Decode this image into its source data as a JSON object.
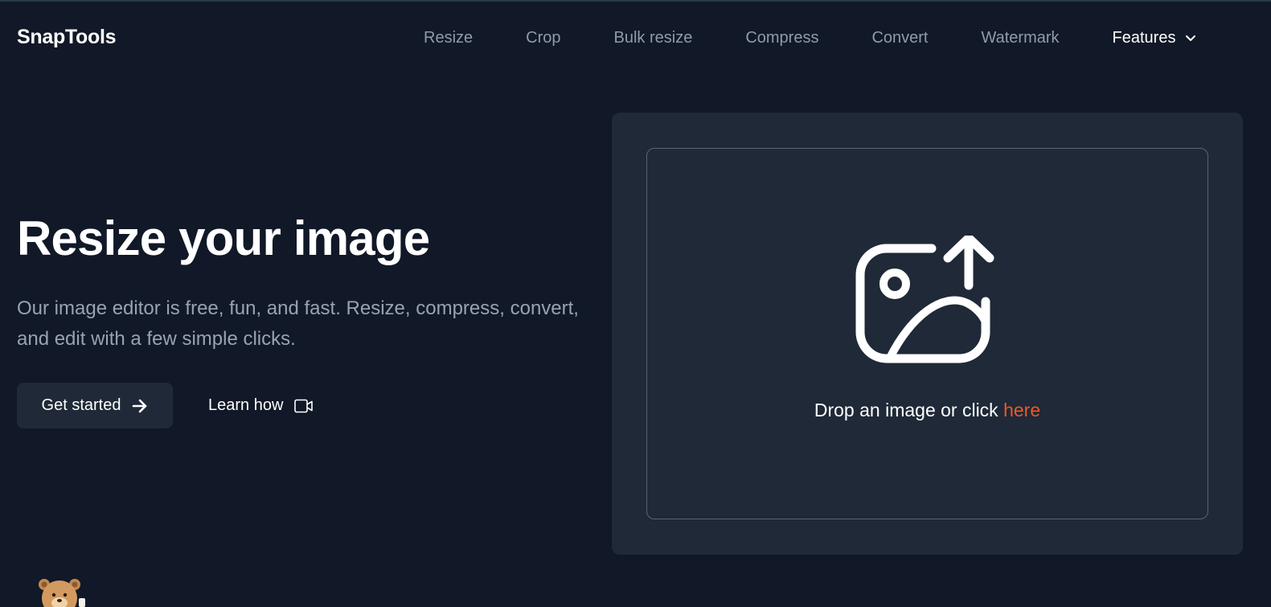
{
  "brand": {
    "name": "SnapTools"
  },
  "nav": {
    "items": [
      {
        "label": "Resize"
      },
      {
        "label": "Crop"
      },
      {
        "label": "Bulk resize"
      },
      {
        "label": "Compress"
      },
      {
        "label": "Convert"
      },
      {
        "label": "Watermark"
      }
    ],
    "features_label": "Features",
    "features_icon": "chevron-down-icon"
  },
  "hero": {
    "title": "Resize your image",
    "subtitle": "Our image editor is free, fun, and fast. Resize, compress, convert, and edit with a few simple clicks.",
    "primary_button": {
      "label": "Get started",
      "icon": "arrow-right-icon"
    },
    "secondary_button": {
      "label": "Learn how",
      "icon": "video-icon"
    }
  },
  "upload": {
    "icon": "image-upload-icon",
    "prompt": "Drop an image or click ",
    "link": "here"
  },
  "colors": {
    "background": "#111827",
    "card": "#1f2937",
    "muted_text": "#8f9bab",
    "accent": "#ea5a28"
  },
  "mascot": {
    "icon": "bear-mascot-icon"
  }
}
